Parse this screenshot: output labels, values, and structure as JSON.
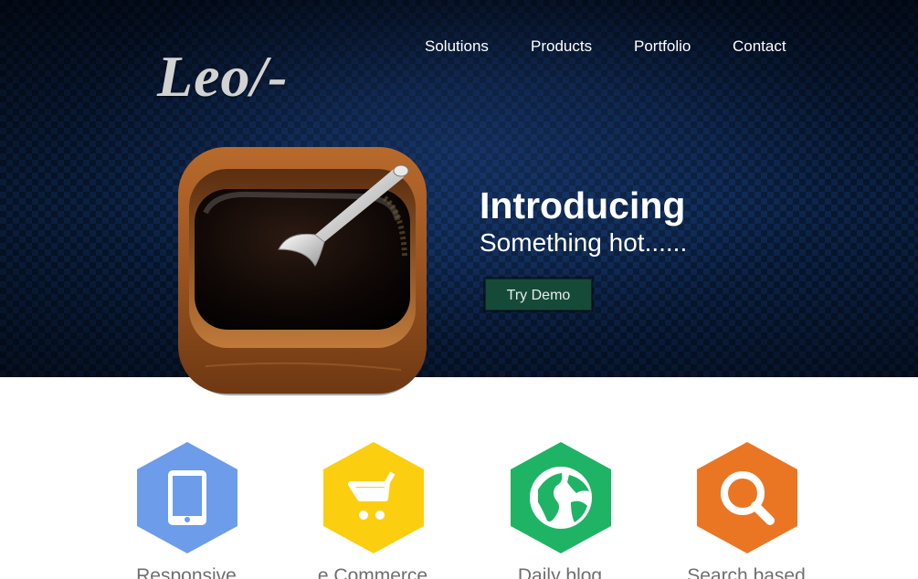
{
  "brand": {
    "logo_text": "Leo/-"
  },
  "nav": {
    "items": [
      {
        "label": "Solutions"
      },
      {
        "label": "Products"
      },
      {
        "label": "Portfolio"
      },
      {
        "label": "Contact"
      }
    ]
  },
  "hero": {
    "title": "Introducing",
    "subtitle": "Something hot......",
    "demo_button": "Try Demo",
    "icon": "coffee-box-app-icon"
  },
  "features": [
    {
      "label": "Responsive",
      "icon": "smartphone-icon",
      "color": "#6c9cea"
    },
    {
      "label": "e Commerce",
      "icon": "shopping-cart-icon",
      "color": "#fbcf0f"
    },
    {
      "label": "Daily blog",
      "icon": "globe-icon",
      "color": "#1fb366"
    },
    {
      "label": "Search based",
      "icon": "search-icon",
      "color": "#ea7624"
    }
  ],
  "colors": {
    "hero_background": "#0b1d3a",
    "demo_button": "#154a38"
  }
}
